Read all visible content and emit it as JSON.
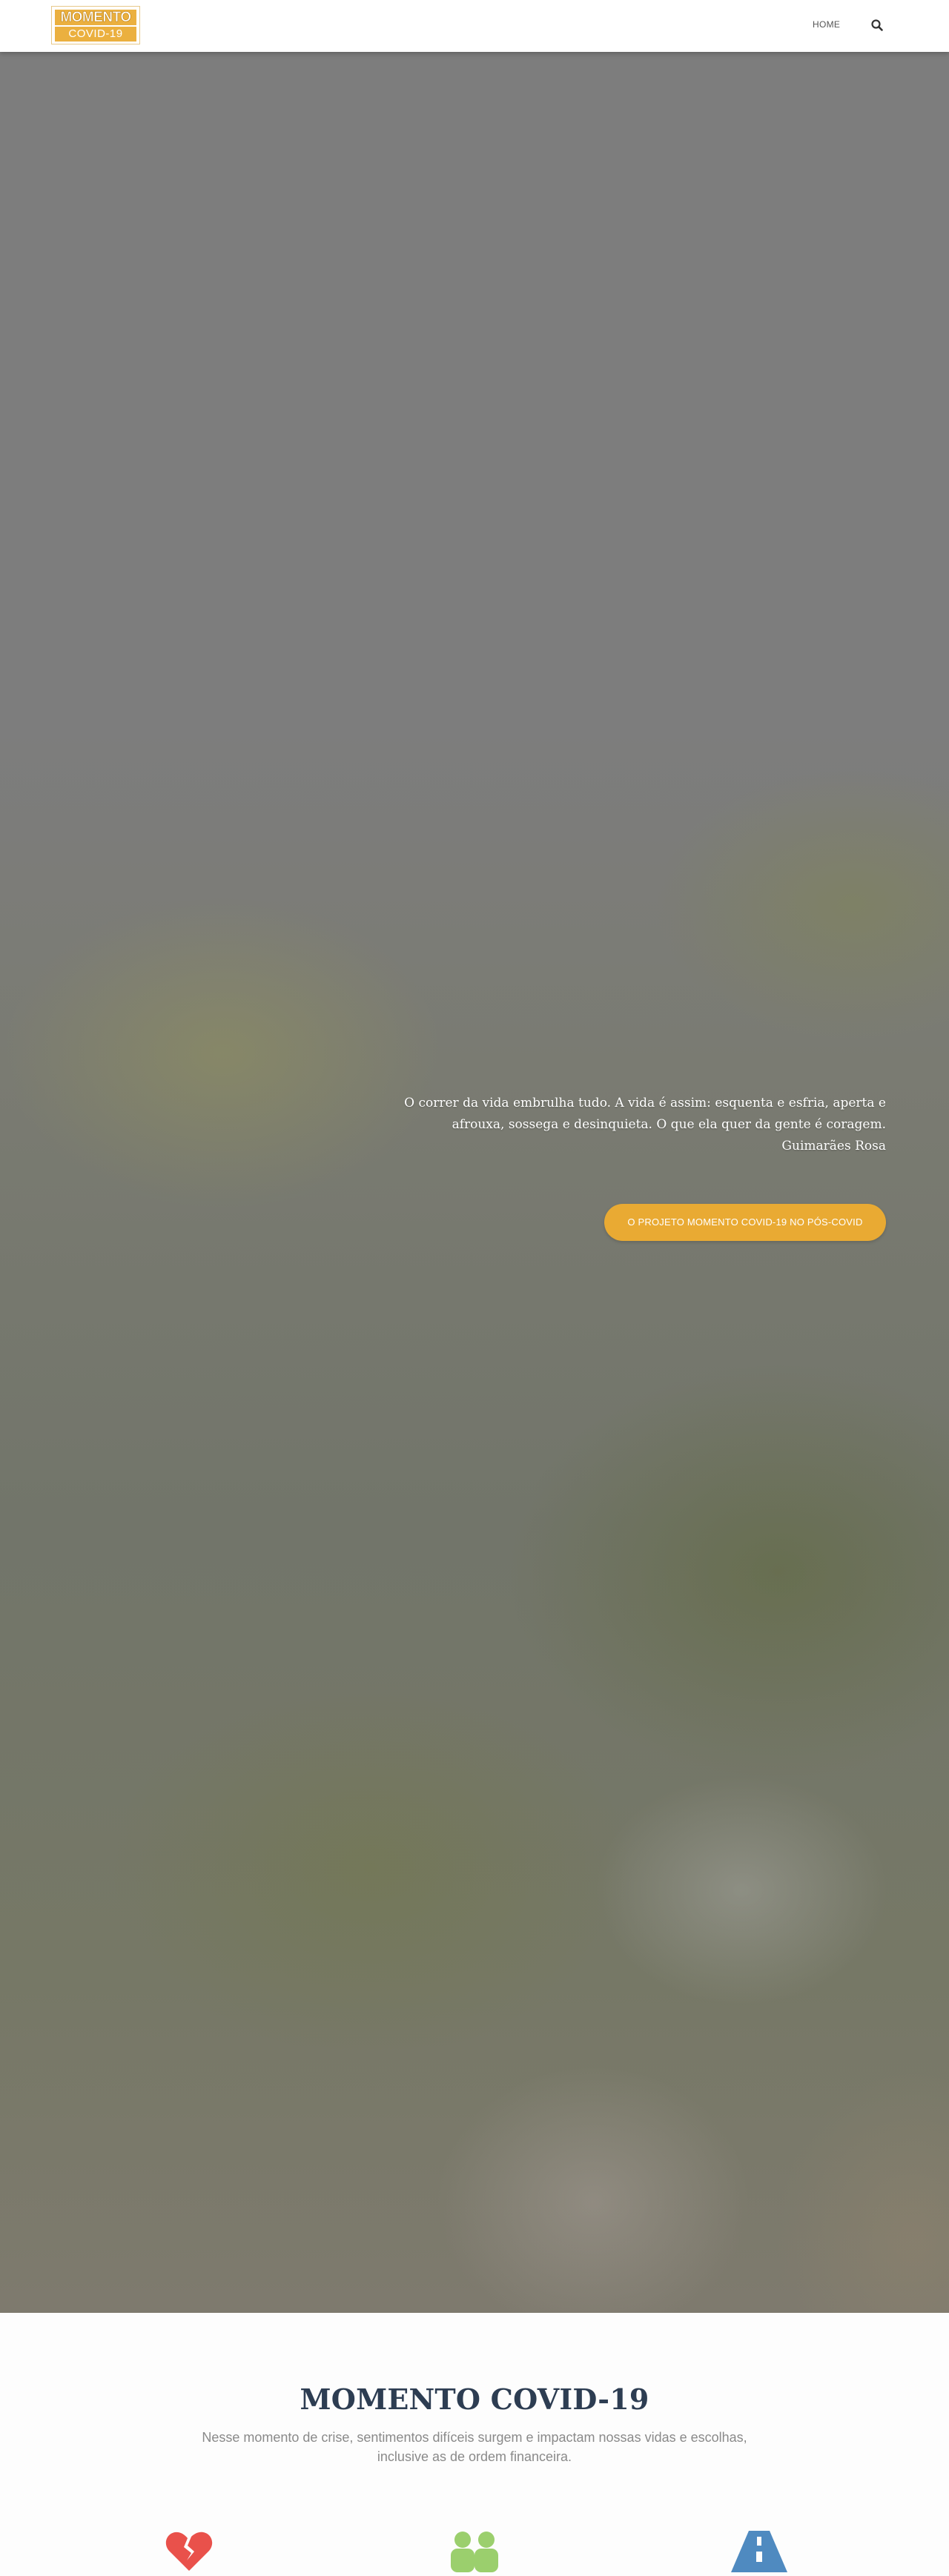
{
  "header": {
    "logo_line1": "MOMENTO",
    "logo_line2": "COVID-19",
    "nav": [
      {
        "label": "HOME"
      }
    ],
    "search_icon": "search-icon"
  },
  "hero": {
    "quote_lines": [
      "O correr da vida embrulha tudo. A vida é assim: esquenta e esfria, aperta e",
      "afrouxa, sossega e desinquieta. O que ela quer da gente é coragem.",
      "Guimarães Rosa"
    ],
    "cta_label": "O PROJETO MOMENTO COVID-19 NO PÓS-COVID"
  },
  "section": {
    "title": "MOMENTO COVID-19",
    "subtitle_lines": [
      "Nesse momento de crise, sentimentos difíceis surgem e impactam nossas vidas e escolhas,",
      "inclusive as de ordem financeira."
    ],
    "features": [
      {
        "icon": "broken-heart-icon",
        "color": "#e9514b"
      },
      {
        "icon": "users-icon",
        "color": "#9bcf6d"
      },
      {
        "icon": "road-icon",
        "color": "#4f8ac0"
      }
    ]
  },
  "colors": {
    "accent": "#e9aa33",
    "title": "#2d3d52",
    "subtitle": "#8a8a8a"
  }
}
